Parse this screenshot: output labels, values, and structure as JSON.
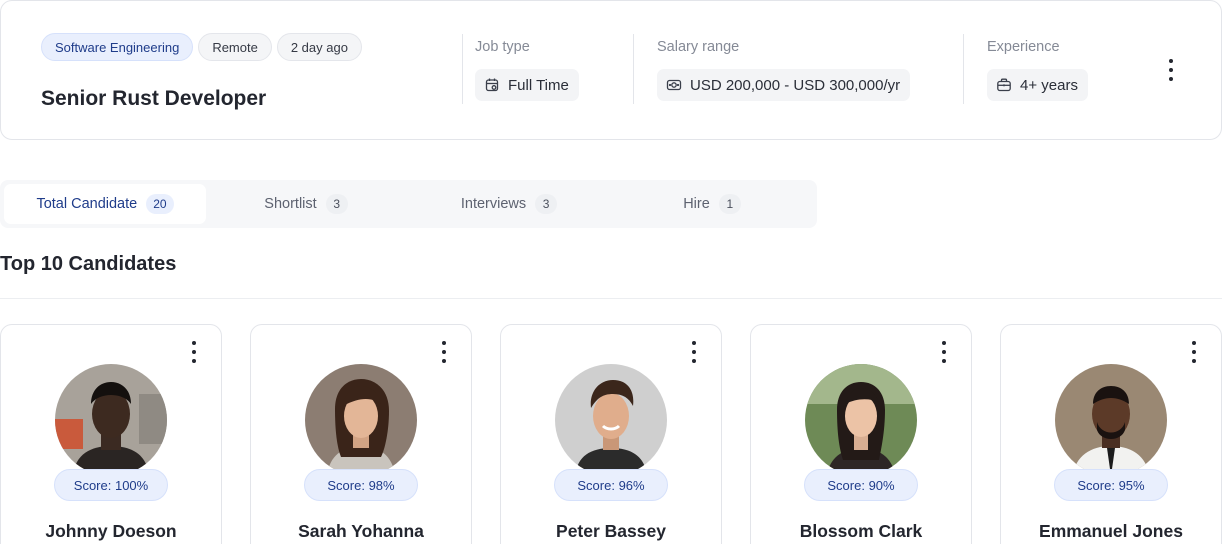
{
  "job": {
    "tags": [
      "Software Engineering",
      "Remote",
      "2 day ago"
    ],
    "title": "Senior Rust Developer",
    "job_type_label": "Job type",
    "job_type_value": "Full Time",
    "salary_label": "Salary range",
    "salary_value": "USD 200,000 - USD 300,000/yr",
    "experience_label": "Experience",
    "experience_value": "4+ years"
  },
  "tabs": [
    {
      "label": "Total Candidate",
      "count": "20",
      "active": true
    },
    {
      "label": "Shortlist",
      "count": "3",
      "active": false
    },
    {
      "label": "Interviews",
      "count": "3",
      "active": false
    },
    {
      "label": "Hire",
      "count": "1",
      "active": false
    }
  ],
  "section_title": "Top 10 Candidates",
  "candidates": [
    {
      "name": "Johnny Doeson",
      "score": "Score: 100%"
    },
    {
      "name": "Sarah Yohanna",
      "score": "Score: 98%"
    },
    {
      "name": "Peter Bassey",
      "score": "Score: 96%"
    },
    {
      "name": "Blossom Clark",
      "score": "Score: 90%"
    },
    {
      "name": "Emmanuel Jones",
      "score": "Score: 95%"
    }
  ],
  "colors": {
    "accent": "#1f3c8a",
    "accent_bg": "#e9effd",
    "border": "#e3e5ea",
    "muted_text": "#858a96"
  },
  "icons": {
    "job_type": "calendar-icon",
    "salary": "money-icon",
    "experience": "briefcase-icon",
    "menu": "more-vertical-icon"
  }
}
